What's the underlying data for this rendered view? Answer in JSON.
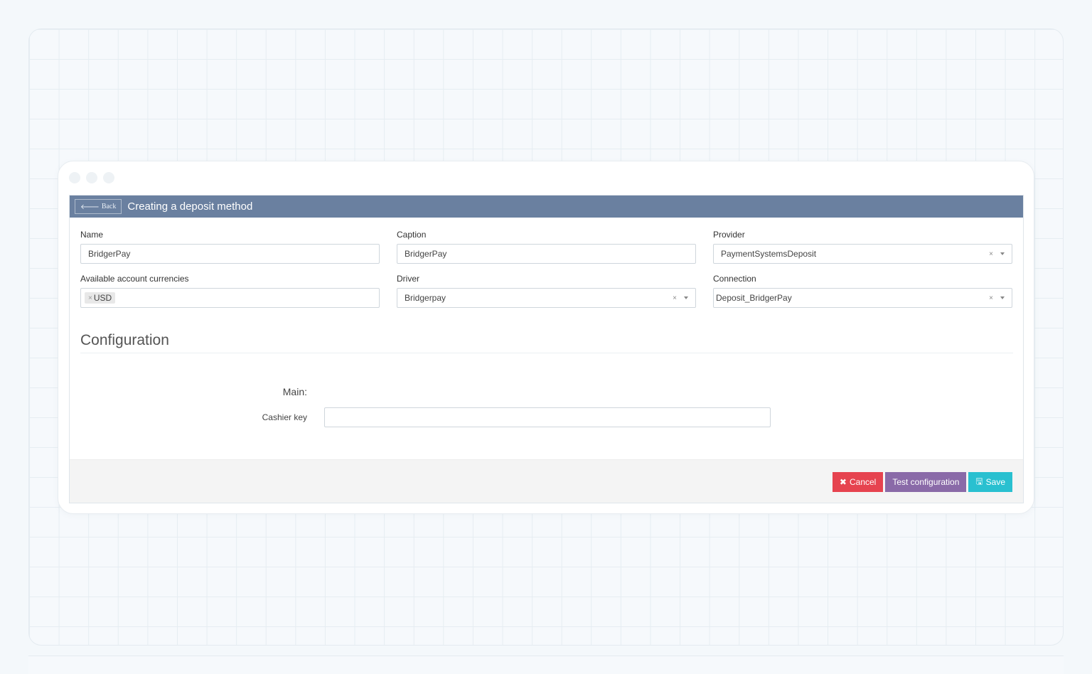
{
  "header": {
    "back_label": "Back",
    "title": "Creating a deposit method"
  },
  "form": {
    "name": {
      "label": "Name",
      "value": "BridgerPay"
    },
    "caption": {
      "label": "Caption",
      "value": "BridgerPay"
    },
    "provider": {
      "label": "Provider",
      "value": "PaymentSystemsDeposit"
    },
    "currencies": {
      "label": "Available account currencies",
      "tags": [
        "USD"
      ]
    },
    "driver": {
      "label": "Driver",
      "value": "Bridgerpay"
    },
    "connection": {
      "label": "Connection",
      "value": "Deposit_BridgerPay"
    }
  },
  "configuration": {
    "title": "Configuration",
    "group_label": "Main:",
    "cashier_key": {
      "label": "Cashier key",
      "value": ""
    }
  },
  "footer": {
    "cancel_label": "Cancel",
    "test_label": "Test configuration",
    "save_label": "Save"
  },
  "colors": {
    "header": "#6a80a0",
    "cancel": "#e6434f",
    "test": "#8a6aa8",
    "save": "#29c0d0"
  },
  "icons": {
    "back": "arrow-left-icon",
    "clear": "clear-x-icon",
    "dropdown": "chevron-down-icon",
    "cancel": "times-icon",
    "save": "floppy-disk-icon"
  }
}
